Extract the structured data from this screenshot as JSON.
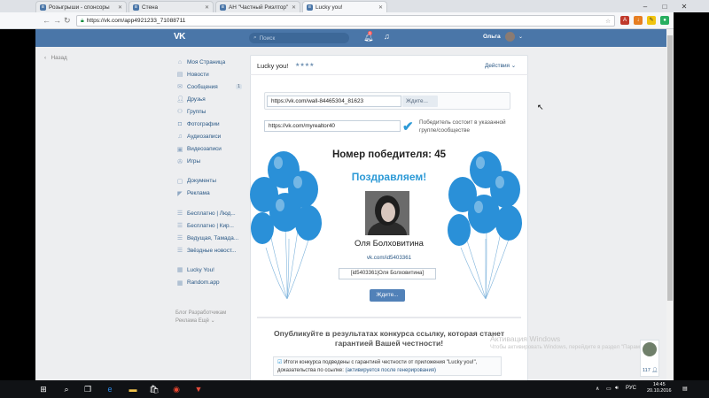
{
  "browser": {
    "tabs": [
      {
        "favicon": "vk-icon",
        "title": "Розыгрыши - спонсоры"
      },
      {
        "favicon": "vk-icon",
        "title": "Стена"
      },
      {
        "favicon": "vk-icon",
        "title": "АН \"Частный Риэлтор\""
      },
      {
        "favicon": "vk-icon",
        "title": "Lucky you!"
      }
    ],
    "url": "https://vk.com/app4921233_71088711"
  },
  "vk": {
    "logo": "VK",
    "search_placeholder": "Поиск",
    "notifications_count": "1",
    "user_name": "Ольга",
    "back_label": "Назад",
    "menu": [
      {
        "icon": "home-icon",
        "label": "Моя Страница"
      },
      {
        "icon": "news-icon",
        "label": "Новости"
      },
      {
        "icon": "messages-icon",
        "label": "Сообщения",
        "count": "1"
      },
      {
        "icon": "friends-icon",
        "label": "Друзья"
      },
      {
        "icon": "groups-icon",
        "label": "Группы"
      },
      {
        "icon": "photos-icon",
        "label": "Фотографии"
      },
      {
        "icon": "audio-icon",
        "label": "Аудиозаписи"
      },
      {
        "icon": "video-icon",
        "label": "Видеозаписи"
      },
      {
        "icon": "games-icon",
        "label": "Игры"
      }
    ],
    "menu2": [
      {
        "icon": "documents-icon",
        "label": "Документы"
      },
      {
        "icon": "ads-icon",
        "label": "Реклама"
      }
    ],
    "menu3": [
      {
        "icon": "bookmark-icon",
        "label": "Бесплатно | Люд..."
      },
      {
        "icon": "bookmark-icon",
        "label": "Бесплатно | Кир..."
      },
      {
        "icon": "bookmark-icon",
        "label": "Ведущая, Тамада..."
      },
      {
        "icon": "bookmark-icon",
        "label": "Звёздные новост..."
      }
    ],
    "menu4": [
      {
        "icon": "app-icon",
        "label": "Lucky You!"
      },
      {
        "icon": "app-icon",
        "label": "Random.app"
      }
    ],
    "footer": {
      "line1": "Блог   Разработчикам",
      "line2": "Реклама   Ещё ⌄"
    }
  },
  "app": {
    "title": "Lucky you!",
    "rating": "★★★★",
    "actions_label": "Действия ⌄",
    "post_url": "https://vk.com/wall-84465304_81623",
    "wait_label": "Ждите...",
    "group_url": "https://vk.com/myrealtor40",
    "group_check_label": "Победитель состоит в указанной группе/сообществе",
    "winner_number_text": "Номер победителя: 45",
    "congrats": "Поздравляем!",
    "winner_name": "Оля Болховитина",
    "winner_link": "vk.com/id5403361",
    "winner_tag": "[id5403361|Оля Болховитина]",
    "wait_button": "Ждите...",
    "publish_text": "Опубликуйте в результатах конкурса ссылку, которая станет гарантией Вашей честности!",
    "notice_text": "Итоги конкурса подведены с гарантией честности от приложения \"Lucky you!\", доказательства по ссылке:",
    "notice_link": "(активируется после генерирования)"
  },
  "overlay": {
    "watermark_title": "Активация Windows",
    "watermark_sub": "Чтобы активировать Windows, перейдите в раздел \"Параметры\".",
    "chat_count": "117"
  },
  "taskbar": {
    "lang": "РУС",
    "time": "14:45",
    "date": "20.10.2016"
  },
  "colors": {
    "vk_blue": "#4a76a8",
    "accent": "#2d9ad6",
    "balloon": "#2a90d8"
  }
}
